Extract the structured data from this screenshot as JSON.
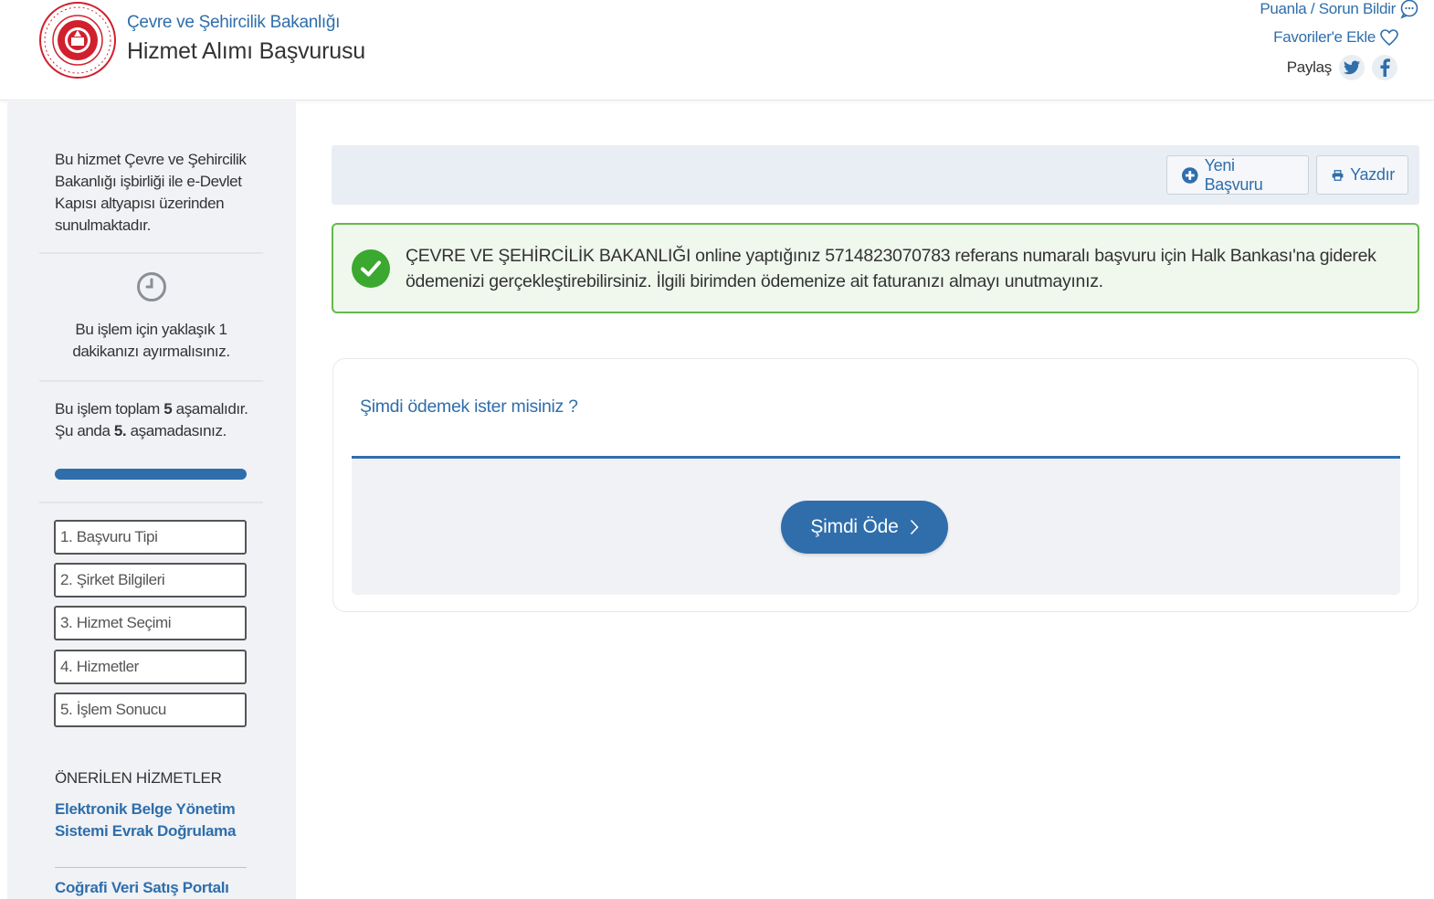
{
  "header": {
    "ministry": "Çevre ve Şehircilik Bakanlığı",
    "service_title": "Hizmet Alımı Başvurusu",
    "rate_link": "Puanla / Sorun Bildir",
    "favorites_link": "Favoriler'e Ekle",
    "share_label": "Paylaş",
    "icons": [
      "chat-icon",
      "heart-icon",
      "twitter-icon",
      "facebook-icon"
    ]
  },
  "sidebar": {
    "intro": "Bu hizmet Çevre ve Şehircilik Bakanlığı işbirliği ile e-Devlet Kapısı altyapısı üzerinden sunulmaktadır.",
    "duration": "Bu işlem için yaklaşık 1 dakikanızı ayırmalısınız.",
    "steps_total_prefix": "Bu işlem toplam ",
    "steps_total": "5",
    "steps_total_suffix": " aşamalıdır.",
    "current_prefix": "Şu anda ",
    "current_step": "5.",
    "current_suffix": " aşamadasınız.",
    "progress": 1.0,
    "steps": [
      "1. Başvuru Tipi",
      "2. Şirket Bilgileri",
      "3. Hizmet Seçimi",
      "4. Hizmetler",
      "5. İşlem Sonucu"
    ],
    "recommended_heading": "ÖNERİLEN HİZMETLER",
    "recommended": [
      "Elektronik Belge Yönetim Sistemi Evrak Doğrulama",
      "Coğrafi Veri Satış Portalı"
    ]
  },
  "toolbar": {
    "new_label": "Yeni Başvuru",
    "print_label": "Yazdır"
  },
  "alert": {
    "message": "ÇEVRE VE ŞEHİRCİLİK BAKANLIĞI online yaptığınız 5714823070783 referans numaralı başvuru için Halk Bankası'na giderek ödemenizi gerçekleştirebilirsiniz. İlgili birimden ödemenize ait faturanızı almayı unutmayınız."
  },
  "payment": {
    "question": "Şimdi ödemek ister misiniz ?",
    "pay_label": "Şimdi Öde"
  },
  "colors": {
    "brand_blue": "#2f6eab",
    "success_green": "#3ba82f",
    "emblem_red": "#d0202e"
  }
}
